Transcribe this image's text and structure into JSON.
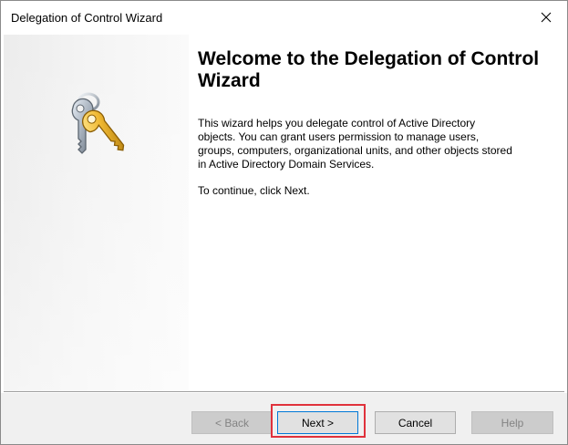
{
  "window": {
    "title": "Delegation of Control Wizard"
  },
  "wizard": {
    "heading": "Welcome to the Delegation of Control Wizard",
    "description": "This wizard helps you delegate control of Active Directory objects. You can grant users permission to manage users, groups, computers, organizational units, and other objects stored in Active Directory Domain Services.",
    "instruction": "To continue, click Next."
  },
  "buttons": {
    "back": "< Back",
    "next": "Next >",
    "cancel": "Cancel",
    "help": "Help"
  },
  "icons": {
    "close": "close-icon",
    "wizard": "keys-icon"
  },
  "colors": {
    "highlight": "#e0323c",
    "focus_border": "#0078d7",
    "footer_bg": "#f0f0f0"
  }
}
